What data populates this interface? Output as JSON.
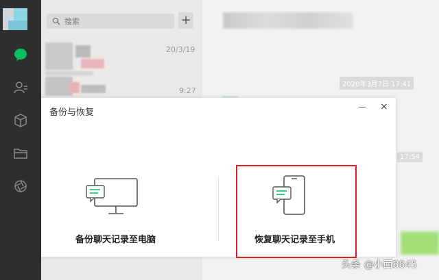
{
  "search": {
    "placeholder": "搜索",
    "add_label": "+"
  },
  "chat_list": [
    {
      "time": "20/3/19"
    },
    {
      "time": "9:27"
    }
  ],
  "chat": {
    "timestamps": [
      "2020年3月7日 17:41",
      "17:54"
    ]
  },
  "dialog": {
    "title": "备份与恢复",
    "minimize_label": "—",
    "close_label": "×",
    "option_backup": "备份聊天记录至电脑",
    "option_restore": "恢复聊天记录至手机"
  },
  "watermark": "头条 @小西8845",
  "colors": {
    "sidebar": "#2e2e2e",
    "accent": "#07c160",
    "highlight": "#e02020"
  }
}
